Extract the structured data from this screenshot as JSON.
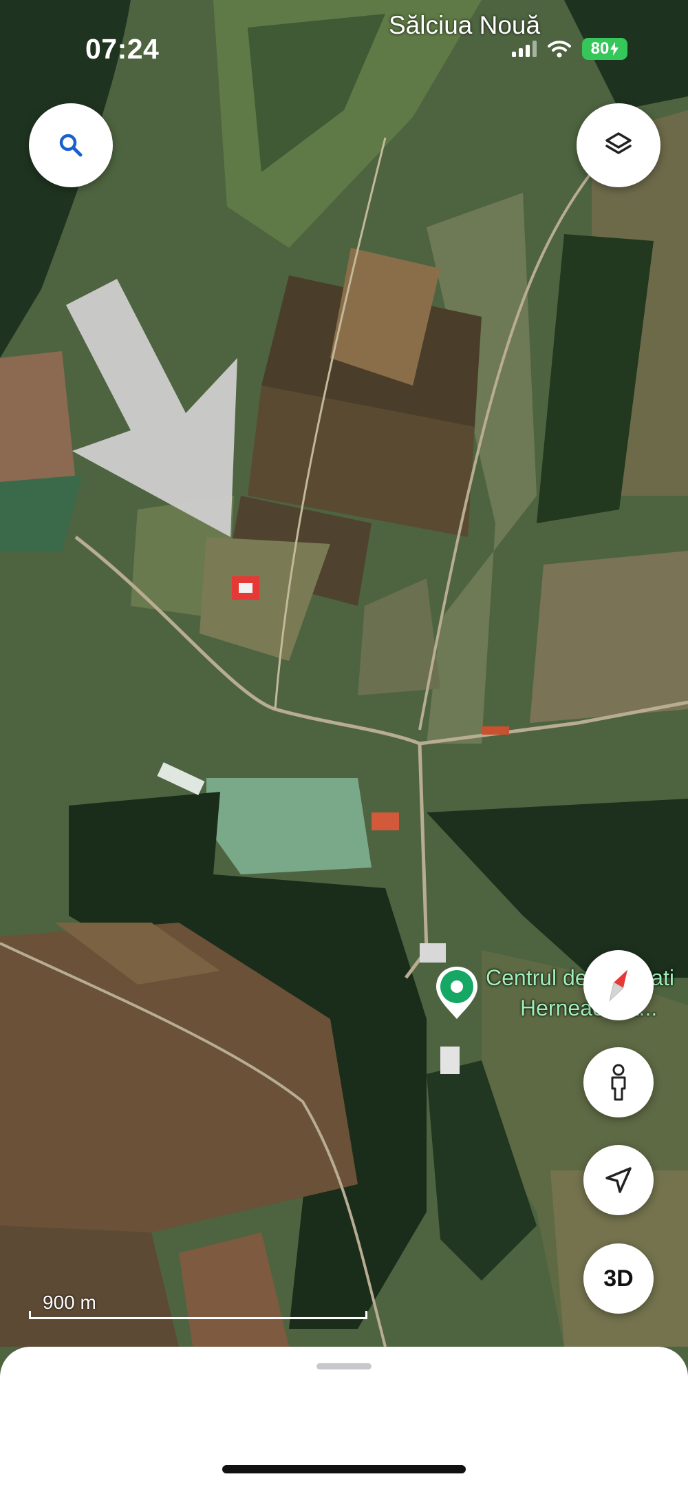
{
  "status_bar": {
    "time": "07:24",
    "battery": "80"
  },
  "map": {
    "type": "satellite",
    "place_label": "Sălciua Nouă",
    "poi": {
      "line1": "Centrul de Vânătati",
      "line2": "Herneacova..."
    },
    "scale": {
      "label": "900 m"
    }
  },
  "controls": {
    "search_icon": "search-icon",
    "layers_icon": "layers-icon",
    "compass_icon": "compass-icon",
    "street_view_icon": "pegman-icon",
    "my_location_icon": "navigation-arrow-icon",
    "three_d_label": "3D"
  },
  "colors": {
    "accent": "#1a5fd0",
    "poi_pin": "#16a765",
    "marker": "#e53935",
    "arrow": "#c7c7c7"
  }
}
